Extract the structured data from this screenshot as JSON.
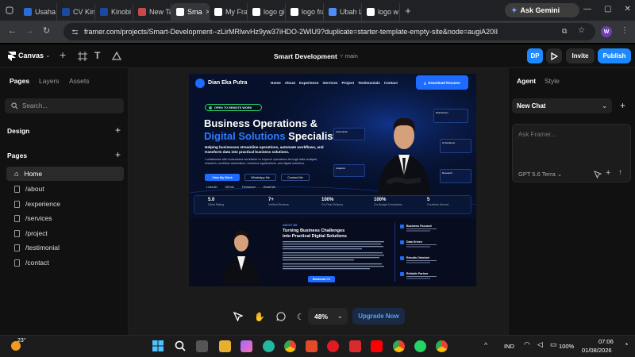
{
  "browser": {
    "tabs": [
      {
        "label": "Usaha I",
        "color": "#2a6bd8"
      },
      {
        "label": "CV Kino",
        "color": "#1a4aa0"
      },
      {
        "label": "Kinobi",
        "color": "#1a4aa0"
      },
      {
        "label": "New Tab",
        "color": "#c94a4a"
      },
      {
        "label": "Sma",
        "color": "#ffffff",
        "active": true
      },
      {
        "label": "My Fra",
        "color": "#ffffff"
      },
      {
        "label": "logo gi",
        "color": "#ffffff"
      },
      {
        "label": "logo fra",
        "color": "#ffffff"
      },
      {
        "label": "Ubah La",
        "color": "#4f8cf7"
      },
      {
        "label": "logo w",
        "color": "#ffffff"
      }
    ],
    "new_tab": "+",
    "gemini_label": "Ask Gemini",
    "url": "framer.com/projects/Smart-Development--zLirMRlwvHz9yw37iHDO-2WlU9?duplicate=starter-template-empty-site&node=augiA20II",
    "profile_initial": "W"
  },
  "framer": {
    "canvas_menu": "Canvas",
    "project_name": "Smart Development",
    "branch": "main",
    "avatar": "DP",
    "invite": "Invite",
    "publish": "Publish",
    "left_tabs": [
      "Pages",
      "Layers",
      "Assets"
    ],
    "search_placeholder": "Search...",
    "design_label": "Design",
    "pages_label": "Pages",
    "pages": [
      "Home",
      "/about",
      "/experience",
      "/services",
      "/project",
      "/testimonial",
      "/contact"
    ],
    "right_tabs": [
      "Agent",
      "Style"
    ],
    "chat_select": "New Chat",
    "ask_placeholder": "Ask Framer...",
    "model": "GPT 5.6 Terra",
    "zoom": "48%",
    "upgrade": "Upgrade Now"
  },
  "site": {
    "brand": "Dian Eka Putra",
    "nav": [
      "Home",
      "About",
      "Experience",
      "Services",
      "Project",
      "Testimonials",
      "Contact"
    ],
    "download_btn": "Download Resume",
    "badge": "OPEN TO REMOTE WORK",
    "headline_1": "Business Operations &",
    "headline_2a": "Digital Solutions",
    "headline_2b": " Specialist",
    "sub": "Helping businesses streamline operations, automate workflows, and transform data into practical business solutions.",
    "para": "I collaborate with businesses worldwide to improve operations through data analysis, research, workflow automation, business applications, and digital solutions.",
    "btn_work": "View My Work",
    "btn_whatsapp": "WhatsApp Me",
    "btn_contact": "Contact Me",
    "socials": [
      "LinkedIn",
      "GitHub",
      "Freelancer",
      "Email Me"
    ],
    "float_cards": [
      "Automation",
      "Analytics",
      "Data Driven",
      "AI Solutions",
      "Research"
    ],
    "stats": [
      {
        "value": "5.0",
        "label": "Client Rating"
      },
      {
        "value": "7+",
        "label": "Verified Reviews"
      },
      {
        "value": "100%",
        "label": "On-Time Delivery"
      },
      {
        "value": "100%",
        "label": "On-Budget Completion"
      },
      {
        "value": "5",
        "label": "Countries Served"
      }
    ],
    "about_tag": "ABOUT ME",
    "about_title_1": "Turning Business Challenges",
    "about_title_2": "into Practical Digital Solutions",
    "about_btn": "Download CV",
    "features": [
      "Business Focused",
      "Data Driven",
      "Results Oriented",
      "Reliable Partner"
    ]
  },
  "taskbar": {
    "weather": "23°",
    "lang": "IND",
    "battery": "100%",
    "time": "07:06",
    "date": "01/08/2026"
  }
}
